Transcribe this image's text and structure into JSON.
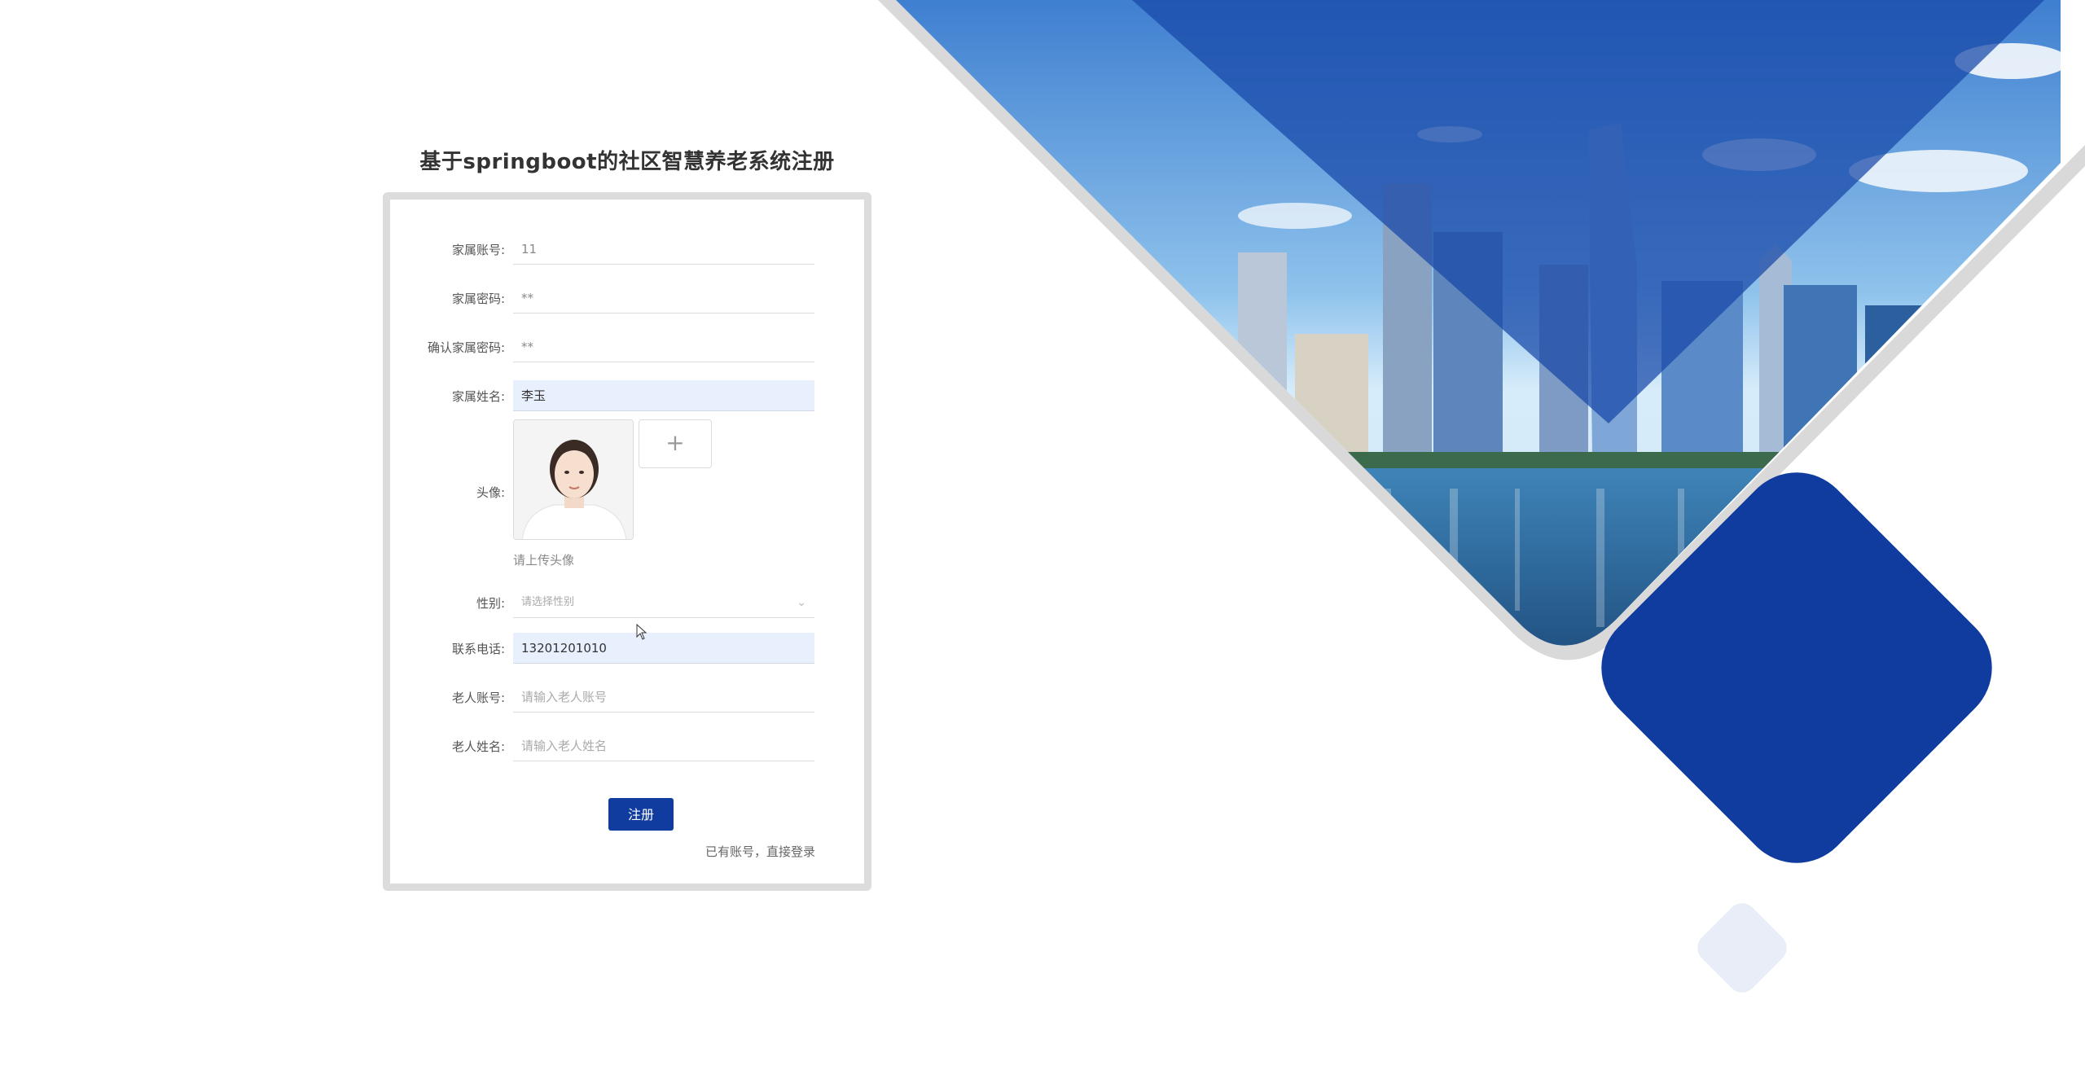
{
  "title": "基于springboot的社区智慧养老系统注册",
  "form": {
    "account": {
      "label": "家属账号:",
      "value": "11"
    },
    "password": {
      "label": "家属密码:",
      "value": "**"
    },
    "confirm_password": {
      "label": "确认家属密码:",
      "value": "**"
    },
    "name": {
      "label": "家属姓名:",
      "value": "李玉"
    },
    "avatar": {
      "label": "头像:",
      "hint": "请上传头像",
      "upload_icon": "plus-icon"
    },
    "gender": {
      "label": "性别:",
      "placeholder": "请选择性别"
    },
    "phone": {
      "label": "联系电话:",
      "value": "13201201010"
    },
    "elder_account": {
      "label": "老人账号:",
      "placeholder": "请输入老人账号"
    },
    "elder_name": {
      "label": "老人姓名:",
      "placeholder": "请输入老人姓名"
    },
    "register_label": "注册",
    "login_link": "已有账号，直接登录"
  },
  "colors": {
    "primary": "#0f3c9e",
    "filled_input_bg": "#e8f0fe",
    "card_border": "#dcdcdc",
    "small_diamond": "#e9edf7"
  }
}
